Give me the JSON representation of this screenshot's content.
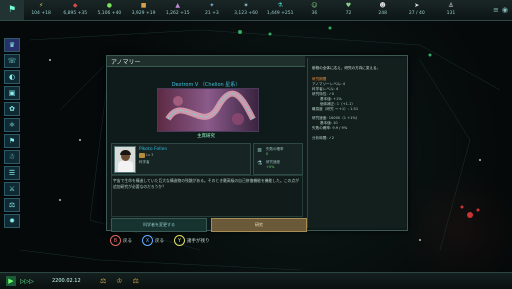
{
  "topbar": {
    "flag_icon": "empire-flag-icon",
    "resources": [
      {
        "icon": "energy-icon",
        "value": "104 +18",
        "color": "#e3d35b"
      },
      {
        "icon": "minerals-icon",
        "value": "6,895 +35",
        "color": "#d54a4a"
      },
      {
        "icon": "food-icon",
        "value": "5,106 +40",
        "color": "#7adf5a"
      },
      {
        "icon": "consumer-goods-icon",
        "value": "3,929 +19",
        "color": "#d7a04a"
      },
      {
        "icon": "alloys-icon",
        "value": "1,262 +15",
        "color": "#c48cd8"
      },
      {
        "icon": "influence-icon",
        "value": "21 +3",
        "color": "#6fb3d9"
      },
      {
        "icon": "unity-icon",
        "value": "3,123 +60",
        "color": "#9ad9e5"
      },
      {
        "icon": "research-icon",
        "value": "1,449 +251",
        "color": "#4ad3c8"
      },
      {
        "icon": "amenities-icon",
        "value": "36",
        "color": "#8fd38c"
      },
      {
        "icon": "stability-icon",
        "value": "72",
        "color": "#8fd38c"
      },
      {
        "icon": "pops-icon",
        "value": "248",
        "color": "#e0e0e0"
      },
      {
        "icon": "fleet-icon",
        "value": "27 / 40",
        "color": "#e0e0e0"
      },
      {
        "icon": "naval-cap-icon",
        "value": "131",
        "color": "#e0e0e0"
      }
    ],
    "right_icons": [
      "menu-icon",
      "notification-icon"
    ]
  },
  "leftbar": {
    "icons": [
      "government-icon",
      "contacts-icon",
      "planets-icon",
      "situation-icon",
      "traditions-icon",
      "technology-icon",
      "factions-icon",
      "species-icon",
      "policies-icon",
      "military-icon",
      "galactic-market-icon",
      "edicts-icon"
    ]
  },
  "dialog": {
    "title": "アノマリー",
    "subject": "Dextrom V （Chelion 星系）",
    "leader_label": "主席研究",
    "leader": {
      "name": "Pikoto Fellen",
      "level": "Lv 3",
      "class": "科学者"
    },
    "stats": [
      {
        "icon": "stack-icon",
        "label": "失敗の確率",
        "value": "0"
      },
      {
        "icon": "flask-icon",
        "label": "研究速度",
        "value": "+0%"
      }
    ],
    "description": "宇宙で生命を構造していた巨大な構造物の残骸がある。そのとき最高級の自己修復機能を機能した。この点が追加研究が必要なのだろうか？",
    "change_button": "科学者を変更する",
    "ok_button": "研究",
    "right_panel": [
      {
        "text": "射程の全体に応え、研究の方向に変える。",
        "color": "#cfe0da"
      },
      {
        "text": "研究期間",
        "color": "#e08a3a"
      },
      {
        "text": "アノマリーレベル: 4",
        "color": "#b4cfc6"
      },
      {
        "text": "科学者レベル: 4",
        "color": "#b4cfc6"
      },
      {
        "text": "研究特性: ✓0",
        "color": "#b4cfc6"
      },
      {
        "text": "基本値: +1%",
        "color": "#b4cfc6"
      },
      {
        "text": "個体補正: 1（+1.1）",
        "color": "#b4cfc6"
      },
      {
        "text": "難易度（研究 → +1）: 1.51",
        "color": "#b4cfc6"
      },
      {
        "text": "",
        "color": "#b4cfc6"
      },
      {
        "text": "研究速度: 10000（1 +1%）",
        "color": "#b4cfc6"
      },
      {
        "text": "基本値: 10",
        "color": "#b4cfc6"
      },
      {
        "text": "失敗の確率: 9.9 / 9%",
        "color": "#b4cfc6"
      },
      {
        "text": "",
        "color": "#b4cfc6"
      },
      {
        "text": "分析時間: ✓2",
        "color": "#b4cfc6"
      }
    ]
  },
  "hints": [
    {
      "icon": "b-button-icon",
      "label": "戻る"
    },
    {
      "icon": "x-button-icon",
      "label": "戻る"
    },
    {
      "icon": "y-button-icon",
      "label": "諸手が残り"
    }
  ],
  "bottombar": {
    "play_icon": "play-icon",
    "speed": "▷▷▷",
    "date": "2200.02.12",
    "icons": [
      "scale-icon",
      "crown-icon",
      "scale-icon"
    ]
  }
}
